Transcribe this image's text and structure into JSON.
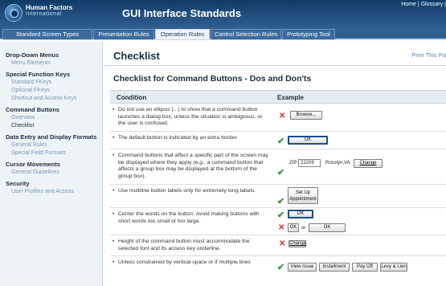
{
  "header": {
    "logo_line1": "Human Factors",
    "logo_line2": "International",
    "title": "GUI Interface Standards",
    "links": "Home | Glossary |"
  },
  "tabs": [
    {
      "label": "Standard Screen Types"
    },
    {
      "label": "Presentation Rules"
    },
    {
      "label": "Operation Rules"
    },
    {
      "label": "Control Selection Rules"
    },
    {
      "label": "Prototyping Tool"
    }
  ],
  "sidebar": {
    "groups": [
      {
        "title": "Drop-Down Menus",
        "items": [
          "Menu Elements"
        ]
      },
      {
        "title": "Special Function Keys",
        "items": [
          "Standard FKeys",
          "Optional FKeys",
          "Shortcut and Access Keys"
        ]
      },
      {
        "title": "Command Buttons",
        "items": [
          "Overview",
          "Checklist"
        ]
      },
      {
        "title": "Data Entry and Display Formats",
        "items": [
          "General Rules",
          "Special Field Formats"
        ]
      },
      {
        "title": "Cursor Movements",
        "items": [
          "General Guidelines"
        ]
      },
      {
        "title": "Security",
        "items": [
          "User Profiles and Access"
        ]
      }
    ]
  },
  "main": {
    "page_title": "Checklist",
    "print_link": "Print This Pa",
    "section_title": "Checklist for Command Buttons - Dos and Don'ts",
    "col_condition": "Condition",
    "col_example": "Example"
  },
  "rows": [
    {
      "condition": "Do not use an ellipsis (...) to show that a command button launches a dialog box, unless the situation is ambiguous, or the user is confused.",
      "browse": "Browse..."
    },
    {
      "condition": "The default button is indicated by an extra border.",
      "ok": "OK"
    },
    {
      "condition": "Command buttons that affect a specific part of the screen may be displayed where they apply (e.g., a command button that affects a group box may be displayed at the bottom of the group box).",
      "zip_label": "ZIP:",
      "zip_value": "22209",
      "city": "Rosslyn,VA",
      "change": "Change"
    },
    {
      "condition": "Use multiline button labels only for extremely long labels.",
      "setup_line1": "Set Up",
      "setup_line2": "Appointment"
    },
    {
      "condition": "Center the words on the button. Avoid making buttons with short words too small or too large.",
      "ok_good": "OK",
      "ok_small": "OK",
      "or": "or",
      "ok_large": "OK"
    },
    {
      "condition": "Height of the command button must accommodate the selected font and its access key underline.",
      "change_bad": "Change"
    },
    {
      "condition": "Unless constrained by vertical space or if multiple lines",
      "b1": "View Issue",
      "b2": "Installment",
      "b3": "Pay Off",
      "b4": "Levy & Lien"
    }
  ],
  "colors": {
    "header_bg": "#214f80",
    "sidebar_bg": "#eef3f8",
    "good": "#2f9a3a",
    "bad": "#d0312d"
  }
}
